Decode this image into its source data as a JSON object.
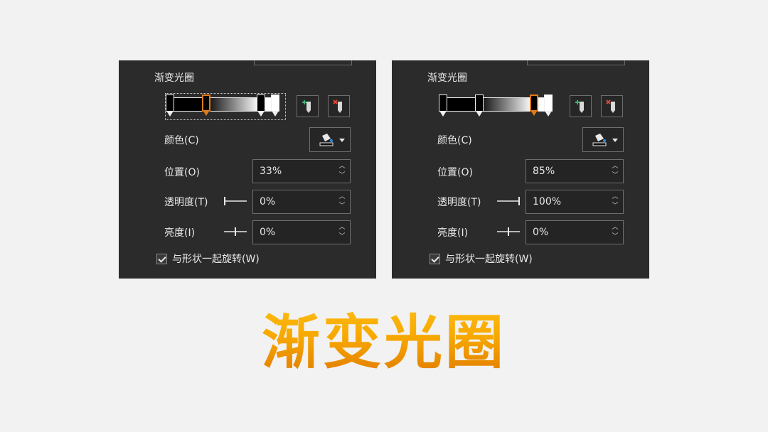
{
  "panels": [
    {
      "section_title": "渐变光圈",
      "gradient": {
        "stops": [
          0,
          33,
          85,
          100
        ],
        "selected_stop": 33,
        "colors": [
          "#000000",
          "#000000",
          "#ffffff",
          "#ffffff"
        ]
      },
      "add_stop_icon": "add-gradient-stop-icon",
      "remove_stop_icon": "remove-gradient-stop-icon",
      "color_label": "颜色(C)",
      "color_button_icon": "paint-bucket-icon",
      "position_label": "位置(O)",
      "position_value": "33%",
      "transparency_label": "透明度(T)",
      "transparency_value": "0%",
      "transparency_level": 0,
      "brightness_label": "亮度(I)",
      "brightness_value": "0%",
      "rotate_label": "与形状一起旋转(W)",
      "rotate_checked": true
    },
    {
      "section_title": "渐变光圈",
      "gradient": {
        "stops": [
          0,
          33,
          85,
          100
        ],
        "selected_stop": 85,
        "colors": [
          "#000000",
          "#000000",
          "#ffffff",
          "#ffffff"
        ]
      },
      "add_stop_icon": "add-gradient-stop-icon",
      "remove_stop_icon": "remove-gradient-stop-icon",
      "color_label": "颜色(C)",
      "color_button_icon": "paint-bucket-icon",
      "position_label": "位置(O)",
      "position_value": "85%",
      "transparency_label": "透明度(T)",
      "transparency_value": "100%",
      "transparency_level": 100,
      "brightness_label": "亮度(I)",
      "brightness_value": "0%",
      "rotate_label": "与形状一起旋转(W)",
      "rotate_checked": true
    }
  ],
  "caption": "渐变光圈",
  "colors": {
    "panel_bg": "#2b2b2b",
    "selected_stop": "#e07a1a",
    "caption_top": "#ffc21a",
    "caption_bottom": "#e07800"
  }
}
